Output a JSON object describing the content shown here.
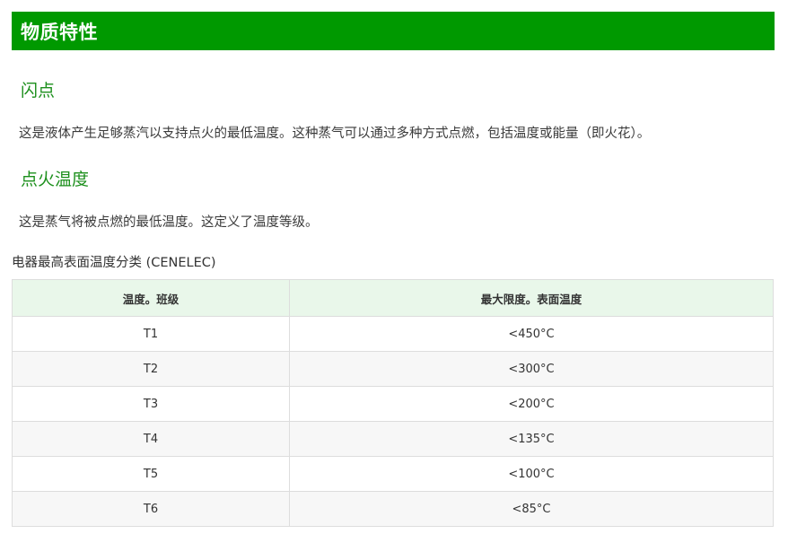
{
  "header": {
    "title": "物质特性"
  },
  "flash_point": {
    "heading": "闪点",
    "text": "这是液体产生足够蒸汽以支持点火的最低温度。这种蒸气可以通过多种方式点燃，包括温度或能量（即火花）。"
  },
  "ignition_temperature": {
    "heading": "点火温度",
    "text": "这是蒸气将被点燃的最低温度。这定义了温度等级。"
  },
  "table": {
    "caption": "电器最高表面温度分类 (CENELEC)",
    "headers": [
      "温度。班级",
      "最大限度。表面温度"
    ],
    "rows": [
      {
        "class": "T1",
        "max_temp": "<450°C"
      },
      {
        "class": "T2",
        "max_temp": "<300°C"
      },
      {
        "class": "T3",
        "max_temp": "<200°C"
      },
      {
        "class": "T4",
        "max_temp": "<135°C"
      },
      {
        "class": "T5",
        "max_temp": "<100°C"
      },
      {
        "class": "T6",
        "max_temp": "<85°C"
      }
    ]
  },
  "colors": {
    "header_bg": "#009900",
    "heading_text": "#1c8f1c",
    "table_header_bg": "#e9f7ea"
  }
}
